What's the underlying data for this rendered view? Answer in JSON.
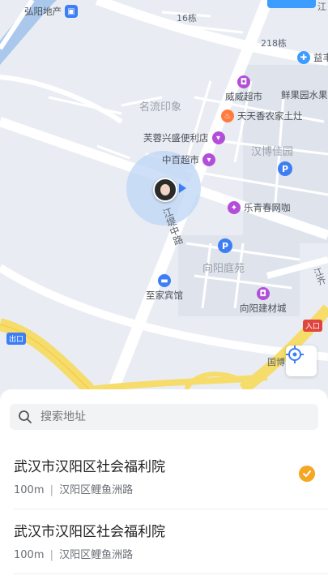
{
  "map": {
    "labels": {
      "hongyang_realestate": "弘阳地产",
      "building_16": "16栋",
      "building_218": "218栋",
      "yifeng": "益丰",
      "weiwei_supermarket": "威威超市",
      "xianguoyuan": "鲜果园水果",
      "mingliu_yinxiang": "名流印象",
      "tiantianxiang": "天天香农家土灶",
      "furongxing": "芙蓉兴盛便利店",
      "hanbo_jiayuan": "汉博佳园",
      "zhongbai": "中百超市",
      "leqingchun": "乐青春网咖",
      "jiangdi_road": "江堤中路",
      "xiangyang_tingyuan": "向阳庭苑",
      "zhijia_hotel": "至家宾馆",
      "xiangyang_building": "向阳建材城",
      "exit": "出口",
      "entrance": "入口",
      "guobo": "国博",
      "jiangqi": "江齐",
      "top_partial": "江"
    },
    "colors": {
      "background": "#e9edf3",
      "road": "#ffffff",
      "highway": "#f6dc6a",
      "water": "#a9c8ec",
      "location_halo": "#bcd6f5",
      "poi_purple": "#b34ed8",
      "poi_orange": "#ff7a3d",
      "parking_blue": "#3d7ef5",
      "accent": "#f5a623"
    }
  },
  "search": {
    "placeholder": "搜索地址"
  },
  "results": [
    {
      "title": "武汉市汉阳区社会福利院",
      "distance": "100m",
      "address": "汉阳区鲤鱼洲路",
      "selected": true
    },
    {
      "title": "武汉市汉阳区社会福利院",
      "distance": "100m",
      "address": "汉阳区鲤鱼洲路",
      "selected": false
    }
  ],
  "separator": "|"
}
